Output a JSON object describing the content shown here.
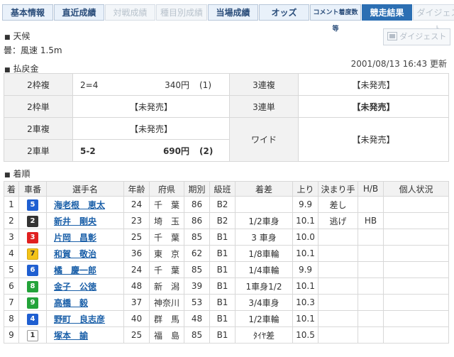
{
  "tabs": [
    {
      "label": "基本情報",
      "state": "normal"
    },
    {
      "label": "直近成績",
      "state": "normal"
    },
    {
      "label": "対戦成績",
      "state": "disabled"
    },
    {
      "label": "種目別成績",
      "state": "disabled"
    },
    {
      "label": "当場成績",
      "state": "normal"
    },
    {
      "label": "オッズ",
      "state": "normal"
    },
    {
      "label": "コメント",
      "label2": "着度数等",
      "state": "normal"
    },
    {
      "label": "競走結果",
      "state": "active"
    },
    {
      "label": "ダイジェスト",
      "state": "disabled"
    }
  ],
  "weather": {
    "heading": "天候",
    "value": "曇：風速 1.5m"
  },
  "digest_button": {
    "label": "ダイジェスト",
    "icon": "film-icon"
  },
  "updated": "2001/08/13 16:43 更新",
  "payout": {
    "heading": "払戻金",
    "rows": [
      {
        "l1": "2枠複",
        "v1a": "2=4",
        "v1b": "340円",
        "v1c": "(1)",
        "l2": "3連複",
        "v2": "【未発売】"
      },
      {
        "l1": "2枠単",
        "v1": "【未発売】",
        "l2": "3連単",
        "v2": "【未発売】"
      },
      {
        "l1": "2車複",
        "v1": "【未発売】",
        "l2": "ワイド",
        "v2": "【未発売】"
      },
      {
        "l1": "2車単",
        "v1a": "5-2",
        "v1b": "690円",
        "v1c": "(2)"
      }
    ]
  },
  "result": {
    "heading": "着順",
    "headers": [
      "着",
      "車番",
      "選手名",
      "年齢",
      "府県",
      "期別",
      "級班",
      "着差",
      "上り",
      "決まり手",
      "H/B",
      "個人状況"
    ],
    "rows": [
      {
        "rank": "1",
        "car": "5",
        "name": "海老根　恵太",
        "age": "24",
        "pref": "千　葉",
        "term": "86",
        "class": "B2",
        "margin": "",
        "agari": "9.9",
        "kimari": "差し",
        "hb": "",
        "status": ""
      },
      {
        "rank": "2",
        "car": "2",
        "name": "新井　剛央",
        "age": "23",
        "pref": "埼　玉",
        "term": "86",
        "class": "B2",
        "margin": "1/2車身",
        "agari": "10.1",
        "kimari": "逃げ",
        "hb": "HB",
        "status": ""
      },
      {
        "rank": "3",
        "car": "3",
        "name": "片岡　昌彰",
        "age": "25",
        "pref": "千　葉",
        "term": "85",
        "class": "B1",
        "margin": "3 車身",
        "agari": "10.0",
        "kimari": "",
        "hb": "",
        "status": ""
      },
      {
        "rank": "4",
        "car": "7",
        "name": "和賀　敬治",
        "age": "36",
        "pref": "東　京",
        "term": "62",
        "class": "B1",
        "margin": "1/8車輪",
        "agari": "10.1",
        "kimari": "",
        "hb": "",
        "status": ""
      },
      {
        "rank": "5",
        "car": "6",
        "name": "橘　慶一郎",
        "age": "24",
        "pref": "千　葉",
        "term": "85",
        "class": "B1",
        "margin": "1/4車輪",
        "agari": "9.9",
        "kimari": "",
        "hb": "",
        "status": ""
      },
      {
        "rank": "6",
        "car": "8",
        "name": "金子　公徳",
        "age": "48",
        "pref": "新　潟",
        "term": "39",
        "class": "B1",
        "margin": "1車身1/2",
        "agari": "10.1",
        "kimari": "",
        "hb": "",
        "status": ""
      },
      {
        "rank": "7",
        "car": "9",
        "name": "高橋　毅",
        "age": "37",
        "pref": "神奈川",
        "term": "53",
        "class": "B1",
        "margin": "3/4車身",
        "agari": "10.3",
        "kimari": "",
        "hb": "",
        "status": ""
      },
      {
        "rank": "8",
        "car": "4",
        "name": "野町　良志彦",
        "age": "40",
        "pref": "群　馬",
        "term": "48",
        "class": "B1",
        "margin": "1/2車輪",
        "agari": "10.1",
        "kimari": "",
        "hb": "",
        "status": ""
      },
      {
        "rank": "9",
        "car": "1",
        "name": "塚本　諭",
        "age": "25",
        "pref": "福　島",
        "term": "85",
        "class": "B1",
        "margin": "ﾀｲﾔ差",
        "agari": "10.5",
        "kimari": "",
        "hb": "",
        "status": ""
      }
    ]
  },
  "car_colors": {
    "1": {
      "bg": "#ffffff",
      "fg": "#333333",
      "border": "#999999"
    },
    "2": {
      "bg": "#333333",
      "fg": "#ffffff",
      "border": "#333333"
    },
    "3": {
      "bg": "#e02020",
      "fg": "#ffffff",
      "border": "#e02020"
    },
    "4": {
      "bg": "#1f5fd1",
      "fg": "#ffffff",
      "border": "#1f5fd1"
    },
    "5": {
      "bg": "#1f5fd1",
      "fg": "#ffffff",
      "border": "#1f5fd1"
    },
    "6": {
      "bg": "#1f5fd1",
      "fg": "#ffffff",
      "border": "#1f5fd1"
    },
    "7": {
      "bg": "#f3c318",
      "fg": "#333333",
      "border": "#d4a50c"
    },
    "8": {
      "bg": "#23a33a",
      "fg": "#ffffff",
      "border": "#23a33a"
    },
    "9": {
      "bg": "#23a33a",
      "fg": "#ffffff",
      "border": "#23a33a"
    }
  }
}
